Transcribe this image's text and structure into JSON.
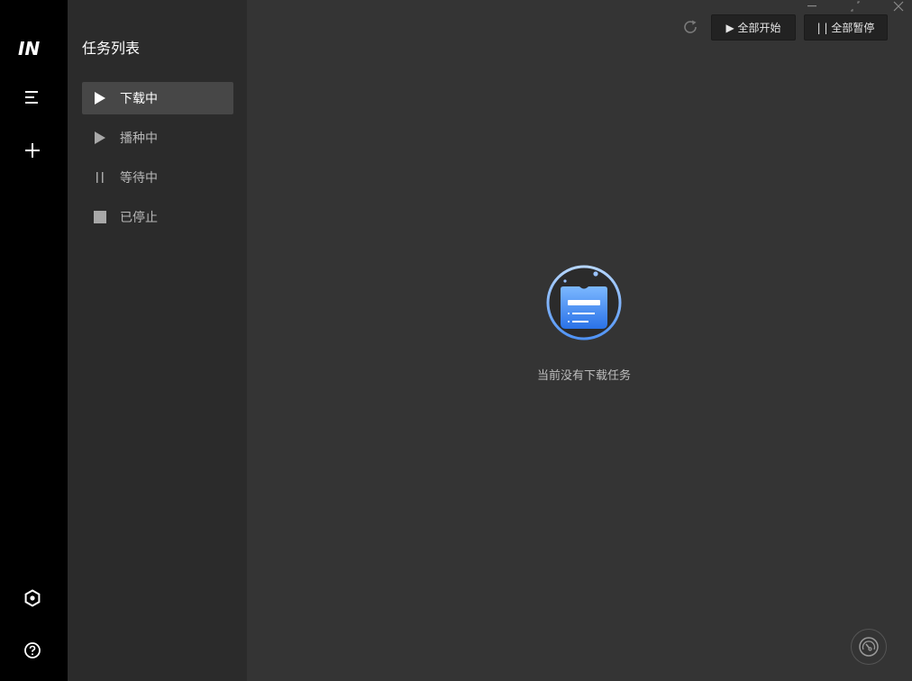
{
  "rail": {
    "logo_text": "IN",
    "items": [
      {
        "name": "menu-icon"
      },
      {
        "name": "add-icon"
      },
      {
        "name": "settings-icon"
      },
      {
        "name": "help-icon"
      }
    ]
  },
  "panel": {
    "title": "任务列表",
    "items": [
      {
        "label": "下载中",
        "icon": "play-icon",
        "active": true
      },
      {
        "label": "播种中",
        "icon": "play-icon",
        "active": false
      },
      {
        "label": "等待中",
        "icon": "pause-icon",
        "active": false
      },
      {
        "label": "已停止",
        "icon": "stop-icon",
        "active": false
      }
    ]
  },
  "toolbar": {
    "start_all_label": "▶ 全部开始",
    "pause_all_label": "| | 全部暂停"
  },
  "main": {
    "empty_text": "当前没有下载任务"
  },
  "colors": {
    "rail_bg": "#000000",
    "panel_bg": "#2b2b2b",
    "main_bg": "#343434",
    "active_item_bg": "#474747",
    "accent": "#3d8ef0"
  }
}
